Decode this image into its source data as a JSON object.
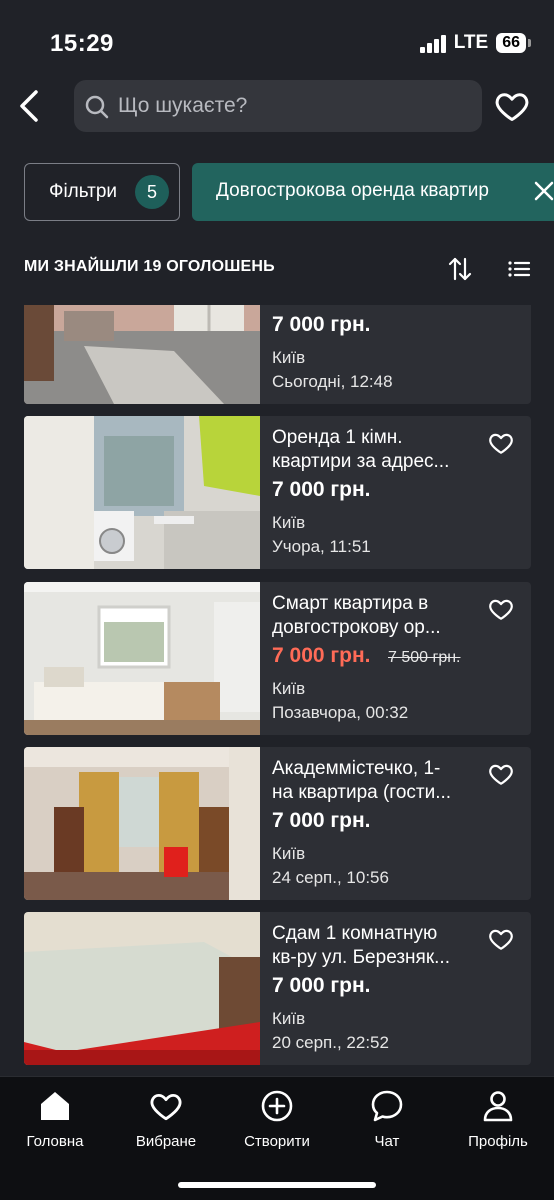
{
  "status_bar": {
    "time": "15:29",
    "network": "LTE",
    "battery": "66"
  },
  "header": {
    "search_placeholder": "Що шукаєте?"
  },
  "filters": {
    "label": "Фільтри",
    "count": "5",
    "active_chip": "Довгострокова оренда квартир"
  },
  "results": {
    "title": "МИ ЗНАЙШЛИ 19 ОГОЛОШЕНЬ"
  },
  "listings": [
    {
      "title_lines": [],
      "price": "7 000 грн.",
      "old_price": "",
      "city": "Київ",
      "date": "Сьогодні, 12:48"
    },
    {
      "title_lines": [
        "Оренда 1 кімн.",
        "квартири за адрес..."
      ],
      "price": "7 000 грн.",
      "old_price": "",
      "city": "Київ",
      "date": "Учора, 11:51"
    },
    {
      "title_lines": [
        "Смарт квартира в",
        "довгострокову ор..."
      ],
      "price": "7 000 грн.",
      "old_price": "7 500 грн.",
      "city": "Київ",
      "date": "Позавчора, 00:32"
    },
    {
      "title_lines": [
        "Академмістечко, 1-",
        "на квартира (гости..."
      ],
      "price": "7 000 грн.",
      "old_price": "",
      "city": "Київ",
      "date": "24 серп., 10:56"
    },
    {
      "title_lines": [
        "Сдам 1 комнатную",
        "кв-ру ул. Березняк..."
      ],
      "price": "7 000 грн.",
      "old_price": "",
      "city": "Київ",
      "date": "20 серп., 22:52"
    }
  ],
  "bottom_nav": [
    {
      "label": "Головна",
      "icon": "home-icon"
    },
    {
      "label": "Вибране",
      "icon": "heart-icon"
    },
    {
      "label": "Створити",
      "icon": "plus-circle-icon"
    },
    {
      "label": "Чат",
      "icon": "chat-icon"
    },
    {
      "label": "Профіль",
      "icon": "profile-icon"
    }
  ],
  "colors": {
    "background": "#202228",
    "card": "#2d2f35",
    "accent_teal": "#22645e",
    "sale_price": "#ff6b57"
  }
}
